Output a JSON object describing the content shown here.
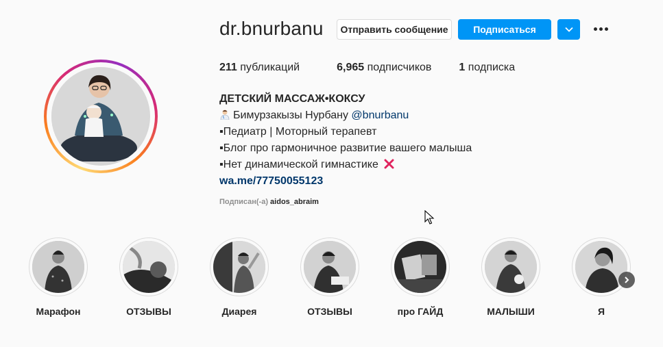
{
  "profile": {
    "username": "dr.bnurbanu",
    "message_button": "Отправить сообщение",
    "follow_button": "Подписаться"
  },
  "stats": {
    "posts_count": "211",
    "posts_label": " публикаций",
    "followers_count": "6,965",
    "followers_label": " подписчиков",
    "following_count": "1",
    "following_label": " подписка"
  },
  "bio": {
    "title": "ДЕТСКИЙ МАССАЖ•КОКСУ",
    "line1_text": "Бимурзакызы Нурбану ",
    "line1_mention": "@bnurbanu",
    "line2": "▪Педиатр | Моторный терапевт",
    "line3": "▪Блог про гармоничное развитие вашего малыша",
    "line4": "▪Нет динамической гимнастике",
    "link": "wa.me/77750055123",
    "followed_by_label": "Подписан(-а) ",
    "followed_by_account": "aidos_abraim"
  },
  "highlights": [
    {
      "label": "Марафон"
    },
    {
      "label": "ОТЗЫВЫ"
    },
    {
      "label": "Диарея"
    },
    {
      "label": "ОТЗЫВЫ"
    },
    {
      "label": "про ГАЙД"
    },
    {
      "label": "МАЛЫШИ"
    },
    {
      "label": "Я"
    }
  ],
  "colors": {
    "accent": "#0095f6",
    "link": "#00376b",
    "cross": "#e0245e"
  },
  "icons": [
    "doctor-emoji-icon",
    "cross-mark-icon",
    "chevron-down-icon",
    "more-options-icon",
    "chevron-right-icon",
    "cursor-icon"
  ]
}
